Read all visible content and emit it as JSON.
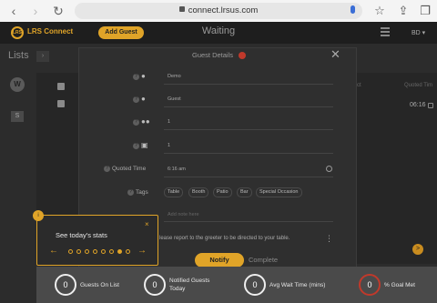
{
  "browser": {
    "url": "connect.lrsus.com",
    "back_glyph": "‹",
    "forward_glyph": "›",
    "reload_glyph": "↻",
    "star_glyph": "☆",
    "share_glyph": "⇪",
    "tabs_glyph": "❐"
  },
  "header": {
    "logo_mark": "LRS",
    "logo_text": "LRS Connect",
    "add_guest_label": "Add Guest",
    "title": "Waiting",
    "user_initials": "BD ▾",
    "accent": "#e0a428"
  },
  "sidebar": {
    "title": "Lists",
    "arrow": "›",
    "avatar_letter": "W",
    "second_item": "S"
  },
  "list": {
    "partial_header_1": "nnect",
    "partial_header_2": "Quoted Tim",
    "partial_time": "06:16"
  },
  "modal": {
    "title": "Guest Details",
    "close": "✕",
    "first_name": "Demo",
    "last_name": "Guest",
    "party_size": "1",
    "table_count": "1",
    "quoted_time_label": "Quoted Time",
    "quoted_time_value": "6:16 am",
    "tags_label": "Tags",
    "tags": [
      "Table",
      "Booth",
      "Patio",
      "Bar",
      "Special Occasion"
    ],
    "add_note_placeholder": "Add note here",
    "notify_message": "lease report to the greeter to be directed to your table.",
    "notify_label": "Notify",
    "complete_label": "Complete"
  },
  "tour": {
    "badge": "i",
    "text": "See today's stats",
    "close": "×",
    "prev": "←",
    "next": "→",
    "total_steps": 8,
    "current_step": 7
  },
  "side_badge": ">",
  "stats": [
    {
      "value": "0",
      "label": "Guests On List"
    },
    {
      "value": "0",
      "label": "Notified Guests Today"
    },
    {
      "value": "0",
      "label": "Avg Wait Time (mins)"
    },
    {
      "value": "0",
      "label": "% Goal Met"
    }
  ]
}
